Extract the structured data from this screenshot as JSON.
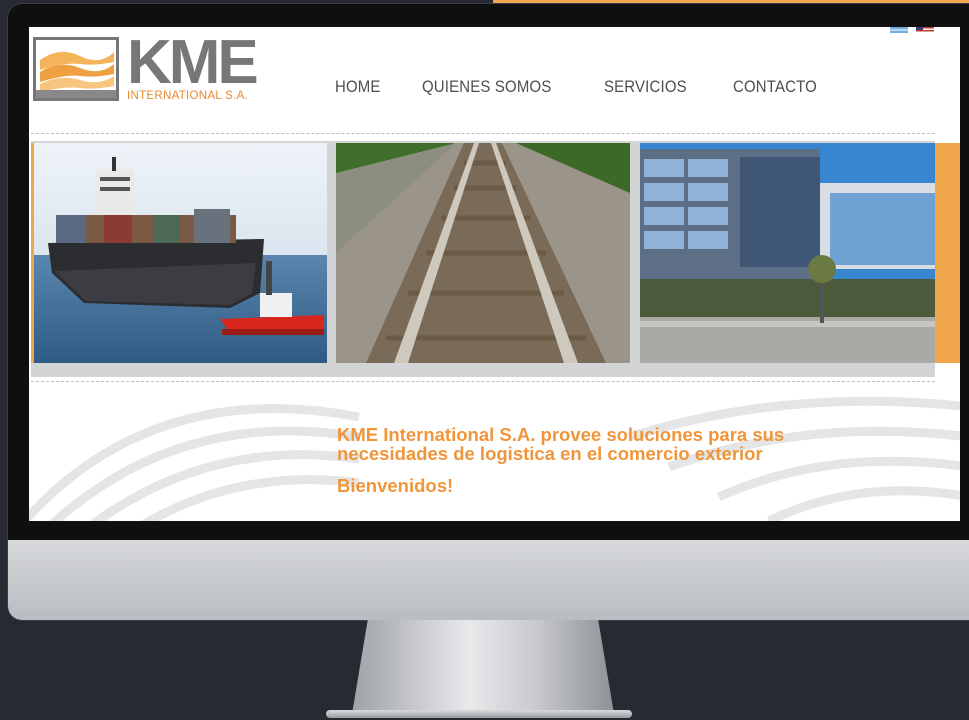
{
  "colors": {
    "accent": "#f0a64a",
    "text_orange": "#f0953a",
    "logo_gray": "#777777",
    "background": "#272a33"
  },
  "logo": {
    "name": "KME",
    "subtitle": "INTERNATIONAL S.A.",
    "icon": "waves-logo-icon"
  },
  "flags": [
    "argentina-flag-icon",
    "usa-flag-icon"
  ],
  "nav": {
    "items": [
      "HOME",
      "QUIENES SOMOS",
      "SERVICIOS",
      "CONTACTO"
    ]
  },
  "gallery": {
    "photos": [
      "cargo-ship-photo",
      "railway-tracks-photo",
      "glass-building-photo"
    ]
  },
  "content": {
    "tagline": "KME International S.A. provee soluciones para sus necesidades de logistica en el comercio exterior",
    "welcome": "Bienvenidos!"
  }
}
